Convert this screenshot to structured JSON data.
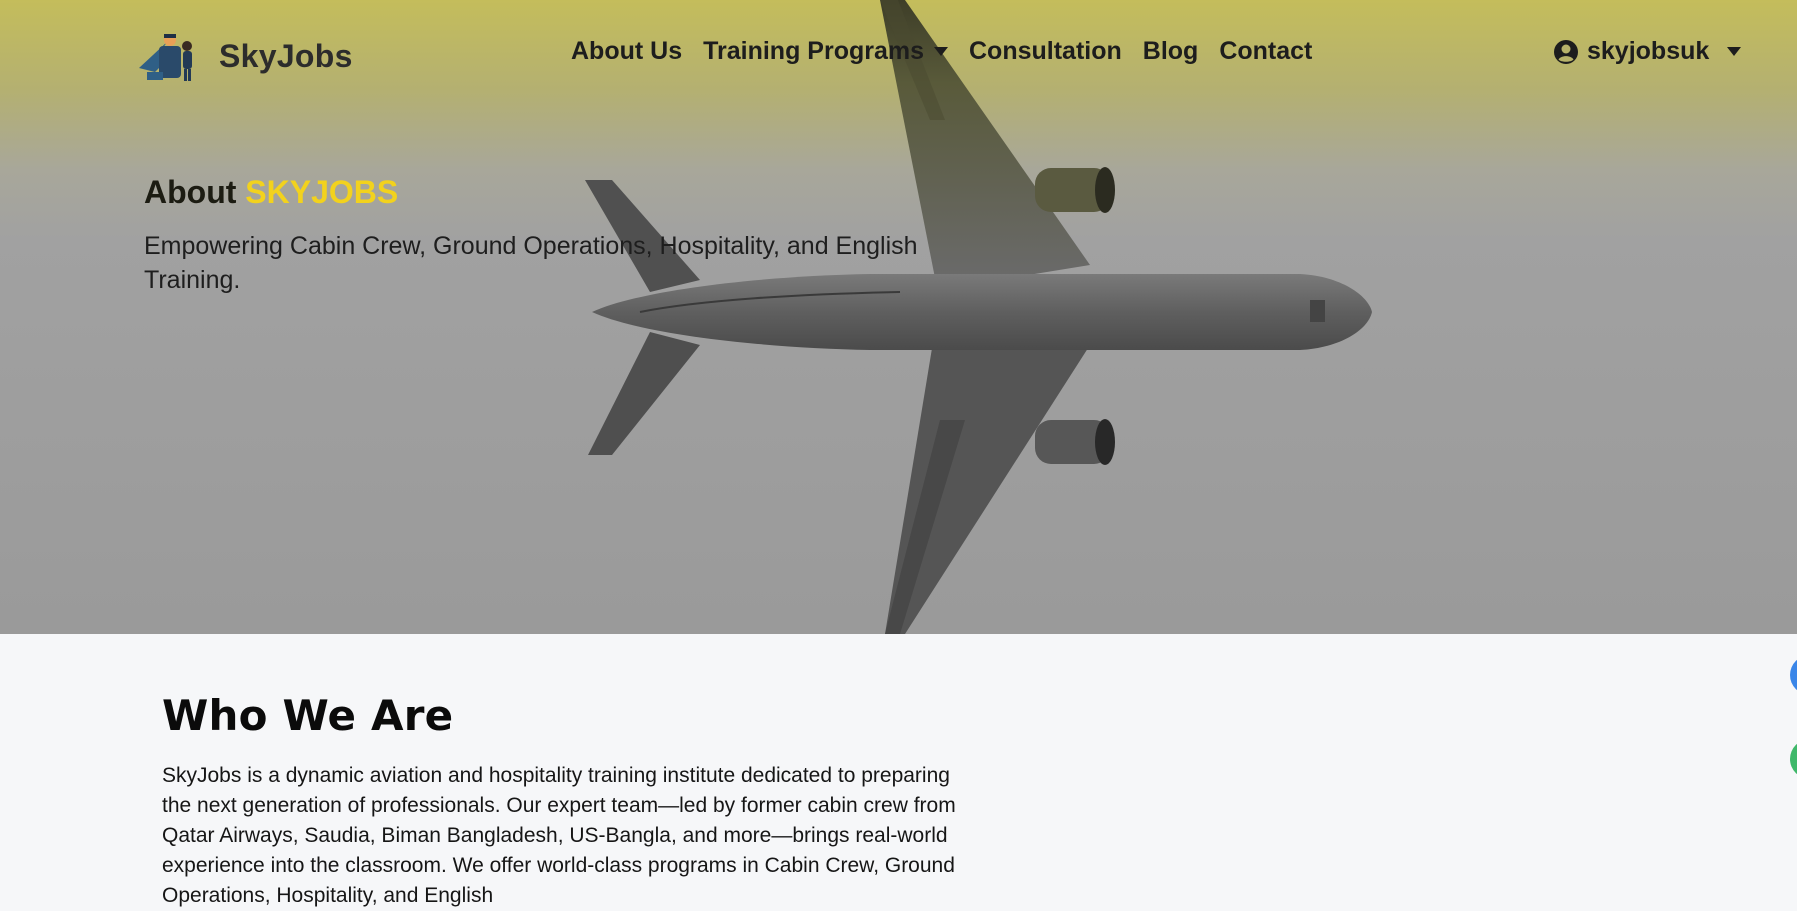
{
  "brand": {
    "name": "SkyJobs"
  },
  "nav": {
    "items": [
      {
        "label": "About Us"
      },
      {
        "label": "Training Programs",
        "has_dropdown": true
      },
      {
        "label": "Consultation"
      },
      {
        "label": "Blog"
      },
      {
        "label": "Contact"
      }
    ],
    "user": {
      "name": "skyjobsuk",
      "icon": "user-circle-icon"
    }
  },
  "hero": {
    "title_prefix": "About ",
    "title_accent": "SKYJOBS",
    "subtitle": "Empowering Cabin Crew, Ground Operations, Hospitality, and English Training."
  },
  "who_we_are": {
    "title": "Who We Are",
    "body": "SkyJobs is a dynamic aviation and hospitality training institute dedicated to preparing the next generation of professionals. Our expert team—led by former cabin crew from Qatar Airways, Saudia, Biman Bangladesh, US-Bangla, and more—brings real-world experience into the classroom. We offer world-class programs in Cabin Crew, Ground Operations, Hospitality, and English"
  },
  "colors": {
    "accent": "#f2d21d",
    "header_tint": "#c4bd5b",
    "hero_gray": "#9a9a9a",
    "page_bg": "#f6f7f9"
  }
}
